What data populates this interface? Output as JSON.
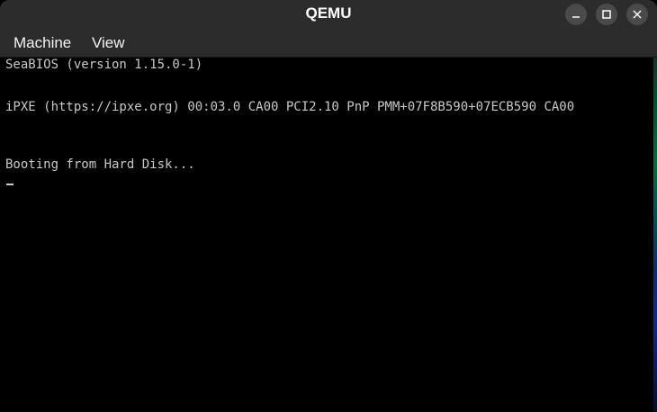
{
  "window": {
    "title": "QEMU",
    "controls": {
      "minimize_icon": "minimize-icon",
      "maximize_icon": "maximize-icon",
      "close_icon": "close-icon"
    }
  },
  "menubar": {
    "items": [
      {
        "label": "Machine"
      },
      {
        "label": "View"
      }
    ]
  },
  "console": {
    "lines": [
      "SeaBIOS (version 1.15.0-1)",
      "iPXE (https://ipxe.org) 00:03.0 CA00 PCI2.10 PnP PMM+07F8B590+07ECB590 CA00",
      "Booting from Hard Disk..."
    ],
    "cursor": "_"
  },
  "colors": {
    "titlebar": "#2c2c2c",
    "console_text": "#c8c8c8",
    "console_bg": "#000000"
  }
}
